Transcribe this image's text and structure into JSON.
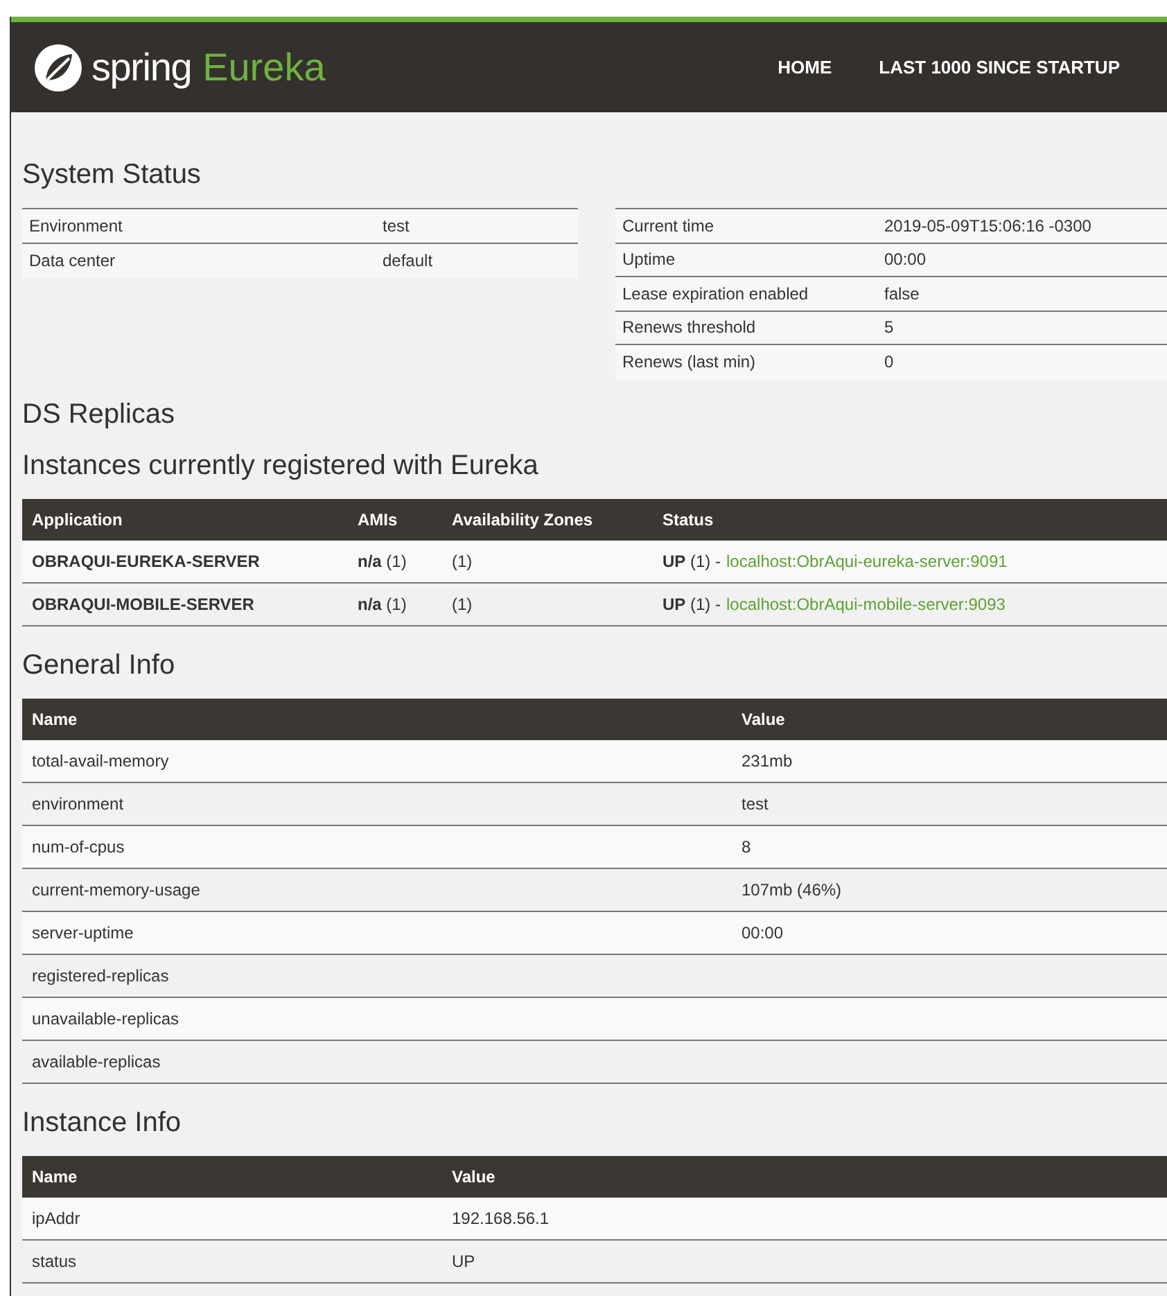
{
  "header": {
    "logo_word": "spring",
    "logo_product": "Eureka",
    "nav": [
      "HOME",
      "LAST 1000 SINCE STARTUP"
    ]
  },
  "system_status": {
    "title": "System Status",
    "left": [
      {
        "label": "Environment",
        "value": "test"
      },
      {
        "label": "Data center",
        "value": "default"
      }
    ],
    "right": [
      {
        "label": "Current time",
        "value": "2019-05-09T15:06:16 -0300"
      },
      {
        "label": "Uptime",
        "value": "00:00"
      },
      {
        "label": "Lease expiration enabled",
        "value": "false"
      },
      {
        "label": "Renews threshold",
        "value": "5"
      },
      {
        "label": "Renews (last min)",
        "value": "0"
      }
    ]
  },
  "ds_replicas": {
    "title": "DS Replicas"
  },
  "instances": {
    "title": "Instances currently registered with Eureka",
    "columns": [
      "Application",
      "AMIs",
      "Availability Zones",
      "Status"
    ],
    "rows": [
      {
        "application": "OBRAQUI-EUREKA-SERVER",
        "amis": "**n/a** (1)",
        "zones": "(1)",
        "status": "**UP** (1) -",
        "link": "localhost:ObrAqui-eureka-server:9091"
      },
      {
        "application": "OBRAQUI-MOBILE-SERVER",
        "amis": "**n/a** (1)",
        "zones": "(1)",
        "status": "**UP** (1) -",
        "link": "localhost:ObrAqui-mobile-server:9093"
      }
    ]
  },
  "general_info": {
    "title": "General Info",
    "columns": [
      "Name",
      "Value"
    ],
    "rows": [
      [
        "total-avail-memory",
        "231mb"
      ],
      [
        "environment",
        "test"
      ],
      [
        "num-of-cpus",
        "8"
      ],
      [
        "current-memory-usage",
        "107mb (46%)"
      ],
      [
        "server-uptime",
        "00:00"
      ],
      [
        "registered-replicas",
        ""
      ],
      [
        "unavailable-replicas",
        ""
      ],
      [
        "available-replicas",
        ""
      ]
    ]
  },
  "instance_info": {
    "title": "Instance Info",
    "columns": [
      "Name",
      "Value"
    ],
    "rows": [
      [
        "ipAddr",
        "192.168.56.1"
      ],
      [
        "status",
        "UP"
      ]
    ]
  }
}
